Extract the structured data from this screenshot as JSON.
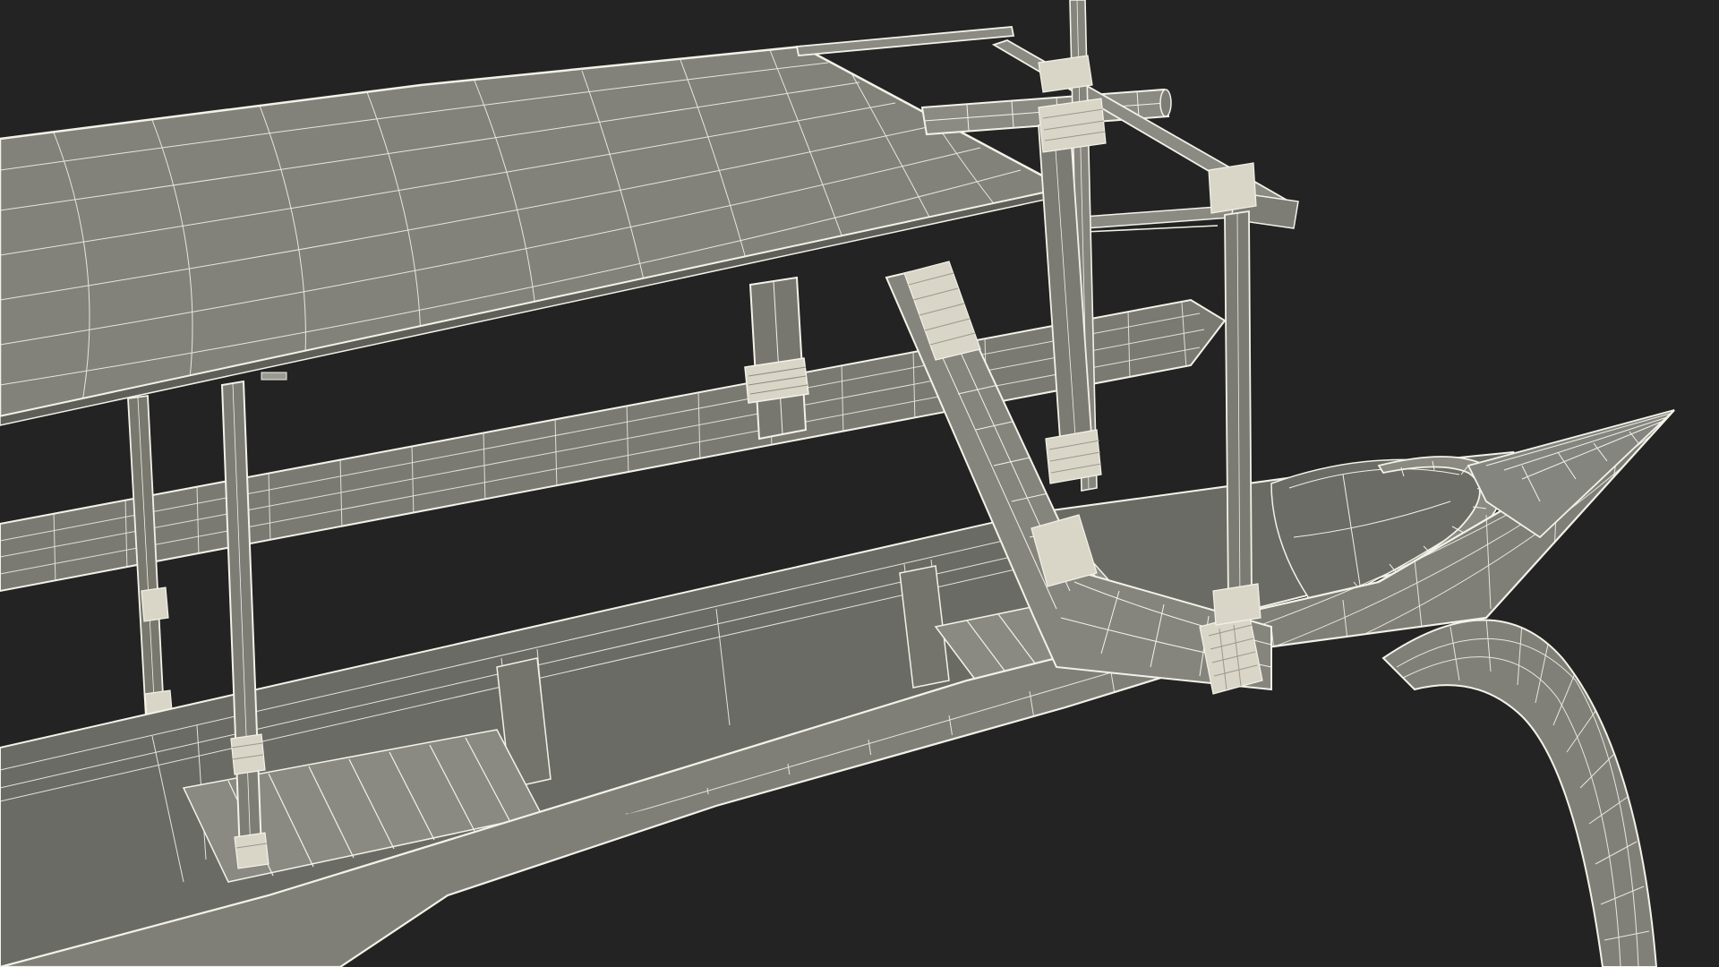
{
  "scene": {
    "background_color": "#232323",
    "surface_color": "#7f7f78",
    "surface_shadow_color": "#6c6c66",
    "surface_highlight_color": "#8a8a83",
    "wire_color": "#f2f2e8",
    "lashing_color": "#ece9dc"
  }
}
